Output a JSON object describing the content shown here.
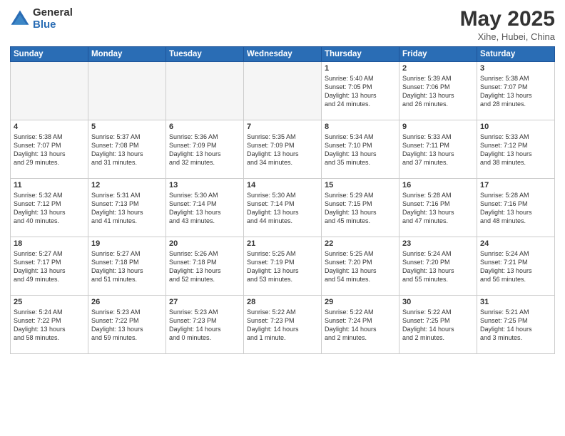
{
  "header": {
    "logo_general": "General",
    "logo_blue": "Blue",
    "month_year": "May 2025",
    "location": "Xihe, Hubei, China"
  },
  "weekdays": [
    "Sunday",
    "Monday",
    "Tuesday",
    "Wednesday",
    "Thursday",
    "Friday",
    "Saturday"
  ],
  "weeks": [
    [
      {
        "day": "",
        "text": ""
      },
      {
        "day": "",
        "text": ""
      },
      {
        "day": "",
        "text": ""
      },
      {
        "day": "",
        "text": ""
      },
      {
        "day": "1",
        "text": "Sunrise: 5:40 AM\nSunset: 7:05 PM\nDaylight: 13 hours\nand 24 minutes."
      },
      {
        "day": "2",
        "text": "Sunrise: 5:39 AM\nSunset: 7:06 PM\nDaylight: 13 hours\nand 26 minutes."
      },
      {
        "day": "3",
        "text": "Sunrise: 5:38 AM\nSunset: 7:07 PM\nDaylight: 13 hours\nand 28 minutes."
      }
    ],
    [
      {
        "day": "4",
        "text": "Sunrise: 5:38 AM\nSunset: 7:07 PM\nDaylight: 13 hours\nand 29 minutes."
      },
      {
        "day": "5",
        "text": "Sunrise: 5:37 AM\nSunset: 7:08 PM\nDaylight: 13 hours\nand 31 minutes."
      },
      {
        "day": "6",
        "text": "Sunrise: 5:36 AM\nSunset: 7:09 PM\nDaylight: 13 hours\nand 32 minutes."
      },
      {
        "day": "7",
        "text": "Sunrise: 5:35 AM\nSunset: 7:09 PM\nDaylight: 13 hours\nand 34 minutes."
      },
      {
        "day": "8",
        "text": "Sunrise: 5:34 AM\nSunset: 7:10 PM\nDaylight: 13 hours\nand 35 minutes."
      },
      {
        "day": "9",
        "text": "Sunrise: 5:33 AM\nSunset: 7:11 PM\nDaylight: 13 hours\nand 37 minutes."
      },
      {
        "day": "10",
        "text": "Sunrise: 5:33 AM\nSunset: 7:12 PM\nDaylight: 13 hours\nand 38 minutes."
      }
    ],
    [
      {
        "day": "11",
        "text": "Sunrise: 5:32 AM\nSunset: 7:12 PM\nDaylight: 13 hours\nand 40 minutes."
      },
      {
        "day": "12",
        "text": "Sunrise: 5:31 AM\nSunset: 7:13 PM\nDaylight: 13 hours\nand 41 minutes."
      },
      {
        "day": "13",
        "text": "Sunrise: 5:30 AM\nSunset: 7:14 PM\nDaylight: 13 hours\nand 43 minutes."
      },
      {
        "day": "14",
        "text": "Sunrise: 5:30 AM\nSunset: 7:14 PM\nDaylight: 13 hours\nand 44 minutes."
      },
      {
        "day": "15",
        "text": "Sunrise: 5:29 AM\nSunset: 7:15 PM\nDaylight: 13 hours\nand 45 minutes."
      },
      {
        "day": "16",
        "text": "Sunrise: 5:28 AM\nSunset: 7:16 PM\nDaylight: 13 hours\nand 47 minutes."
      },
      {
        "day": "17",
        "text": "Sunrise: 5:28 AM\nSunset: 7:16 PM\nDaylight: 13 hours\nand 48 minutes."
      }
    ],
    [
      {
        "day": "18",
        "text": "Sunrise: 5:27 AM\nSunset: 7:17 PM\nDaylight: 13 hours\nand 49 minutes."
      },
      {
        "day": "19",
        "text": "Sunrise: 5:27 AM\nSunset: 7:18 PM\nDaylight: 13 hours\nand 51 minutes."
      },
      {
        "day": "20",
        "text": "Sunrise: 5:26 AM\nSunset: 7:18 PM\nDaylight: 13 hours\nand 52 minutes."
      },
      {
        "day": "21",
        "text": "Sunrise: 5:25 AM\nSunset: 7:19 PM\nDaylight: 13 hours\nand 53 minutes."
      },
      {
        "day": "22",
        "text": "Sunrise: 5:25 AM\nSunset: 7:20 PM\nDaylight: 13 hours\nand 54 minutes."
      },
      {
        "day": "23",
        "text": "Sunrise: 5:24 AM\nSunset: 7:20 PM\nDaylight: 13 hours\nand 55 minutes."
      },
      {
        "day": "24",
        "text": "Sunrise: 5:24 AM\nSunset: 7:21 PM\nDaylight: 13 hours\nand 56 minutes."
      }
    ],
    [
      {
        "day": "25",
        "text": "Sunrise: 5:24 AM\nSunset: 7:22 PM\nDaylight: 13 hours\nand 58 minutes."
      },
      {
        "day": "26",
        "text": "Sunrise: 5:23 AM\nSunset: 7:22 PM\nDaylight: 13 hours\nand 59 minutes."
      },
      {
        "day": "27",
        "text": "Sunrise: 5:23 AM\nSunset: 7:23 PM\nDaylight: 14 hours\nand 0 minutes."
      },
      {
        "day": "28",
        "text": "Sunrise: 5:22 AM\nSunset: 7:23 PM\nDaylight: 14 hours\nand 1 minute."
      },
      {
        "day": "29",
        "text": "Sunrise: 5:22 AM\nSunset: 7:24 PM\nDaylight: 14 hours\nand 2 minutes."
      },
      {
        "day": "30",
        "text": "Sunrise: 5:22 AM\nSunset: 7:25 PM\nDaylight: 14 hours\nand 2 minutes."
      },
      {
        "day": "31",
        "text": "Sunrise: 5:21 AM\nSunset: 7:25 PM\nDaylight: 14 hours\nand 3 minutes."
      }
    ]
  ]
}
